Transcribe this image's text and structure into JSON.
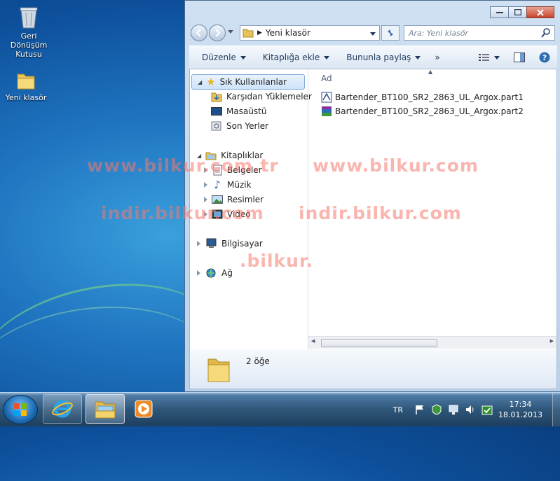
{
  "desktop": {
    "icons": [
      {
        "label": "Geri Dönüşüm Kutusu",
        "icon": "recycle-bin-icon"
      },
      {
        "label": "Yeni klasör",
        "icon": "folder-icon"
      }
    ]
  },
  "explorer": {
    "address": {
      "crumb": "Yeni klasör"
    },
    "search": {
      "placeholder": "Ara: Yeni klasör"
    },
    "toolbar": {
      "organize": "Düzenle",
      "add_to_library": "Kitaplığa ekle",
      "share_with": "Bununla paylaş",
      "more": "»"
    },
    "nav": {
      "favorites": "Sık Kullanılanlar",
      "downloads": "Karşıdan Yüklemeler",
      "desktop": "Masaüstü",
      "recent": "Son Yerler",
      "libraries": "Kitaplıklar",
      "documents": "Belgeler",
      "music": "Müzik",
      "pictures": "Resimler",
      "videos": "Video",
      "computer": "Bilgisayar",
      "network": "Ağ"
    },
    "column_header": "Ad",
    "files": [
      {
        "name": "Bartender_BT100_SR2_2863_UL_Argox.part1"
      },
      {
        "name": "Bartender_BT100_SR2_2863_UL_Argox.part2"
      }
    ],
    "details": {
      "count": "2 öğe"
    }
  },
  "watermarks": [
    "www.bilkur.com.tr",
    "www.bilkur.com",
    "indir.bilkur.com",
    "indir.bilkur.com",
    ".bilkur."
  ],
  "taskbar": {
    "lang": "TR",
    "time": "17:34",
    "date": "18.01.2013"
  },
  "colors": {
    "accent": "#1f74c0",
    "selection": "#cde3fb",
    "watermark": "#f5786e"
  }
}
